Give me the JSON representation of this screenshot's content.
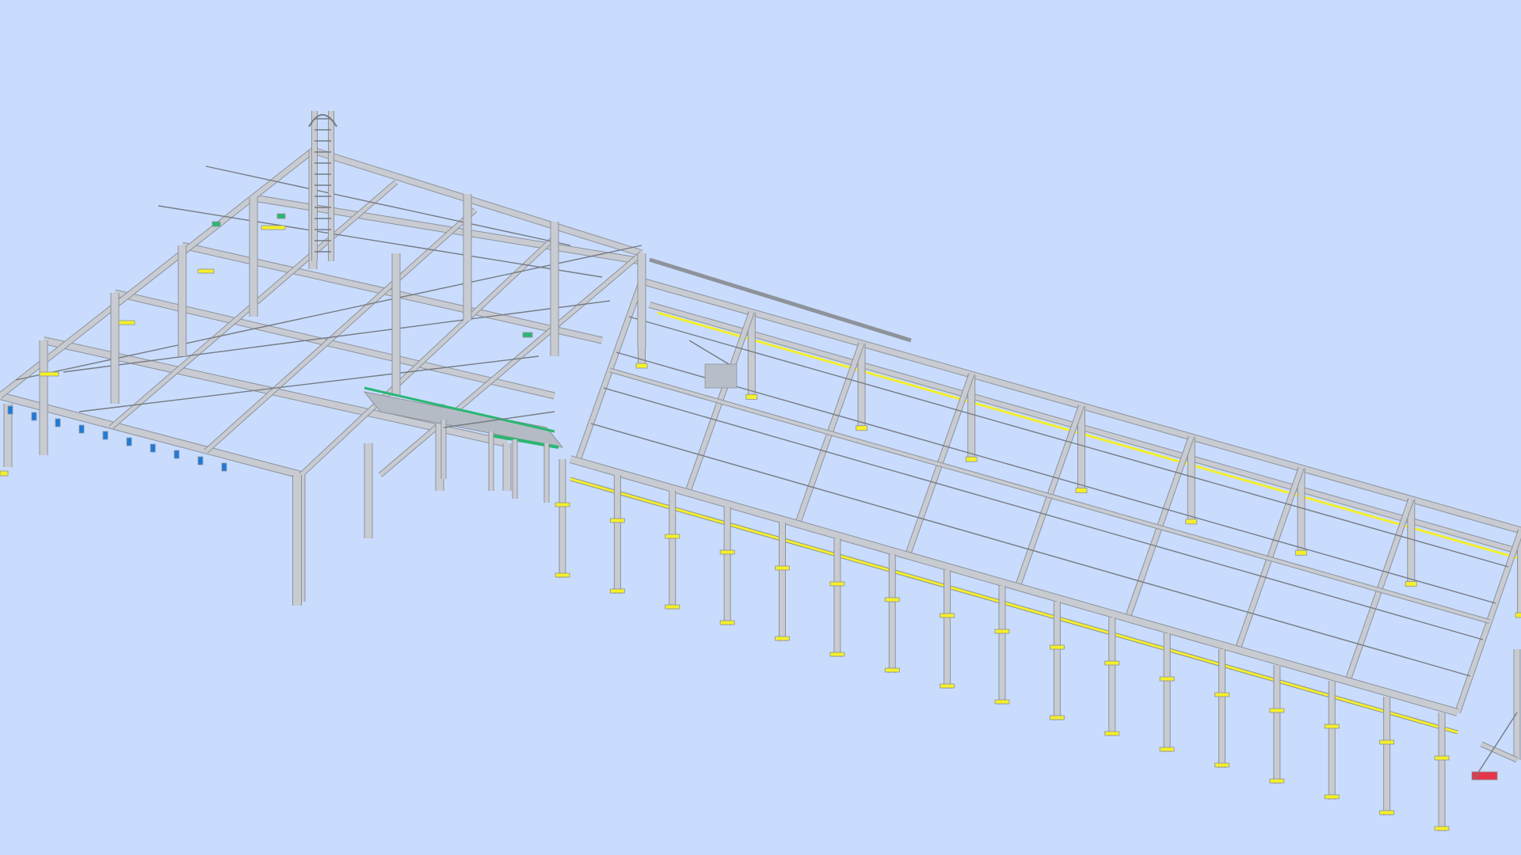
{
  "viewport": {
    "background_color": "#c9dcfd",
    "model": "steel-frame-structure-3d-view"
  },
  "colors": {
    "steel": "#c8cbd1",
    "steel_outline": "#8e939b",
    "steel_dark": "#767b84",
    "highlight_yellow": "#f4ef2a",
    "accent_green": "#2bb673",
    "accent_blue": "#1e7ad9",
    "accent_red": "#e6354a"
  }
}
